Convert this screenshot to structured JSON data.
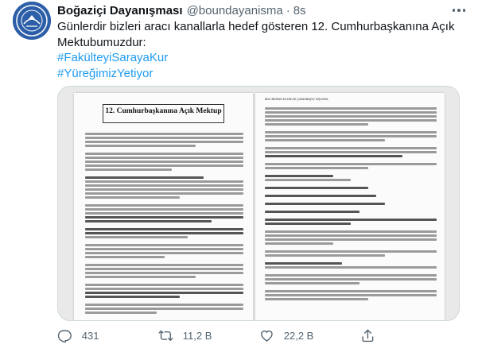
{
  "author": {
    "display_name": "Boğaziçi Dayanışması",
    "handle": "@boundayanisma",
    "separator": "·",
    "time": "8s",
    "avatar_text": "BOĞAZİÇİ DAYANIŞMASI"
  },
  "tweet": {
    "line1": "Günlerdir bizleri aracı kanallarla hedef gösteren 12. Cumhurbaşkanına Açık",
    "line2": "Mektubumuzdur:",
    "hashtags": [
      "#FakülteyiSarayaKur",
      "#YüreğimizYetiyor"
    ]
  },
  "media": {
    "letter_title": "12. Cumhurbaşkanına Açık Mektup",
    "right_top_line": "Biz Berkin Elvan'ın yanındayız diyoruz."
  },
  "actions": {
    "reply": {
      "icon": "reply-icon",
      "count": "431"
    },
    "retweet": {
      "icon": "retweet-icon",
      "count": "11,2 B"
    },
    "like": {
      "icon": "heart-icon",
      "count": "22,2 B"
    },
    "share": {
      "icon": "share-icon"
    }
  },
  "colors": {
    "accent": "#1d9bf0",
    "secondary_text": "#536471",
    "avatar_bg": "#2d5fa8"
  }
}
